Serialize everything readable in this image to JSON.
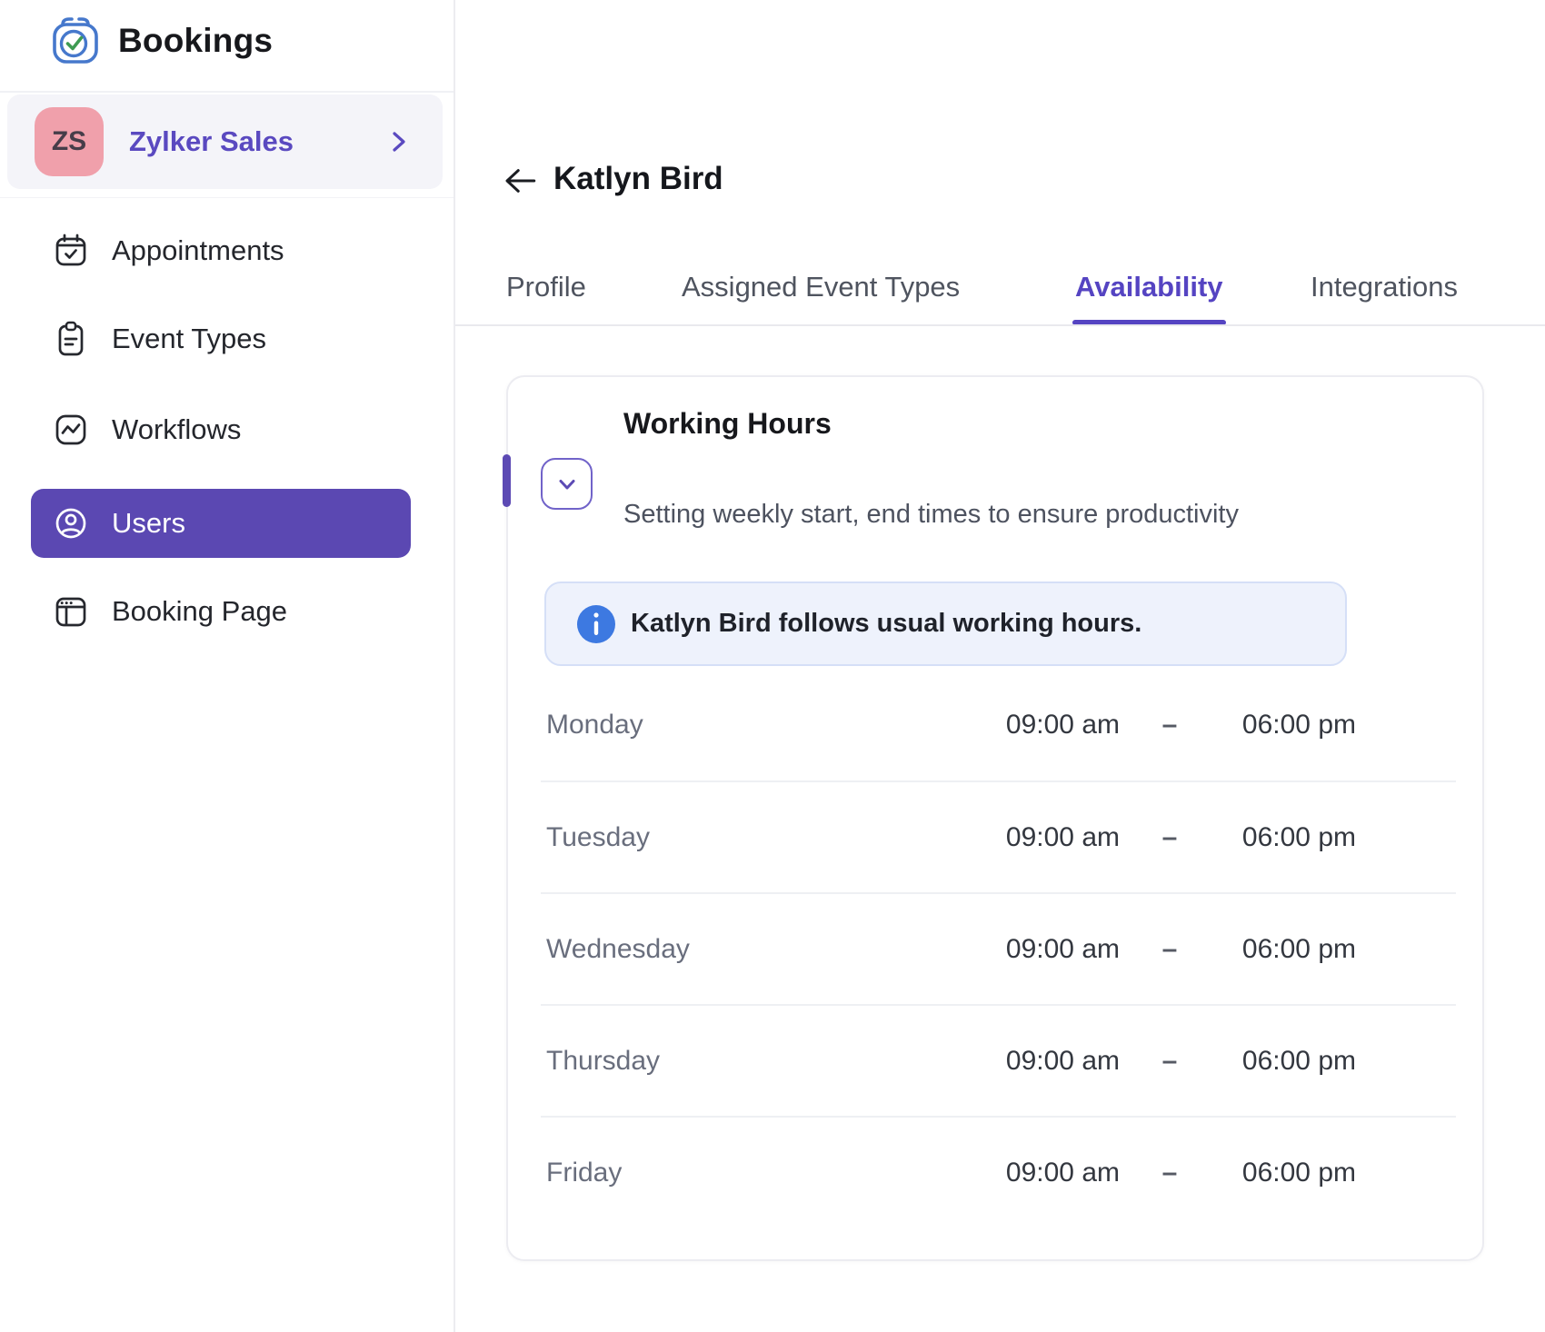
{
  "app": {
    "name": "Bookings"
  },
  "workspace": {
    "initials": "ZS",
    "name": "Zylker Sales"
  },
  "sidebar": {
    "items": [
      {
        "label": "Appointments",
        "icon": "calendar-check-icon",
        "active": false
      },
      {
        "label": "Event Types",
        "icon": "clipboard-icon",
        "active": false
      },
      {
        "label": "Workflows",
        "icon": "workflow-pulse-icon",
        "active": false
      },
      {
        "label": "Users",
        "icon": "user-circle-icon",
        "active": true
      },
      {
        "label": "Booking Page",
        "icon": "browser-window-icon",
        "active": false
      }
    ]
  },
  "header": {
    "title": "Katlyn Bird"
  },
  "tabs": [
    {
      "label": "Profile",
      "active": false
    },
    {
      "label": "Assigned Event Types",
      "active": false
    },
    {
      "label": "Availability",
      "active": true
    },
    {
      "label": "Integrations",
      "active": false
    }
  ],
  "working_hours": {
    "title": "Working Hours",
    "subtitle": "Setting weekly start, end times to ensure productivity",
    "notice": "Katlyn Bird follows usual working hours.",
    "separator": "–",
    "rows": [
      {
        "day": "Monday",
        "start": "09:00 am",
        "end": "06:00 pm"
      },
      {
        "day": "Tuesday",
        "start": "09:00 am",
        "end": "06:00 pm"
      },
      {
        "day": "Wednesday",
        "start": "09:00 am",
        "end": "06:00 pm"
      },
      {
        "day": "Thursday",
        "start": "09:00 am",
        "end": "06:00 pm"
      },
      {
        "day": "Friday",
        "start": "09:00 am",
        "end": "06:00 pm"
      }
    ]
  },
  "colors": {
    "accent_purple": "#5b48b2",
    "tab_active": "#5544c2",
    "avatar_pink": "#f0a0ab",
    "notice_bg": "#eef2fc",
    "info_blue": "#3d79e1",
    "logo_blue": "#4678cc",
    "logo_green": "#3e9b52"
  }
}
